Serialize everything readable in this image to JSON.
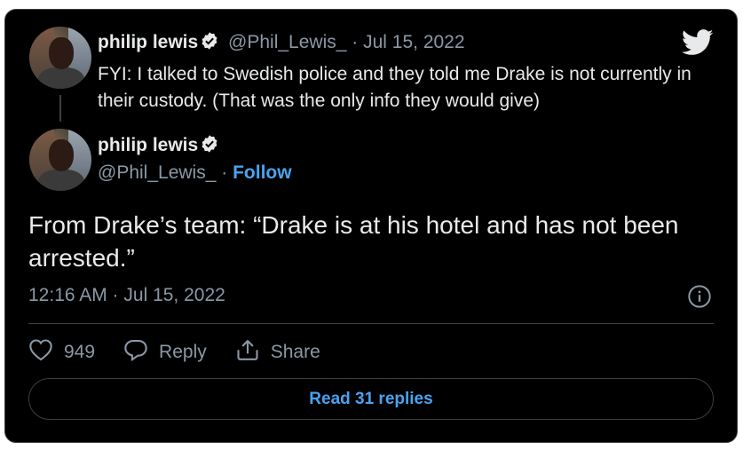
{
  "quoted_tweet": {
    "author_name": "philip lewis",
    "handle": "@Phil_Lewis_",
    "separator": "·",
    "date": "Jul 15, 2022",
    "text": "FYI: I talked to Swedish police and they told me Drake is not currently in their custody. (That was the only info they would give)"
  },
  "main_tweet": {
    "author_name": "philip lewis",
    "handle": "@Phil_Lewis_",
    "separator": "·",
    "follow_label": "Follow",
    "text": "From Drake’s team: “Drake is at his hotel and has not been arrested.”",
    "timestamp": "12:16 AM · Jul 15, 2022"
  },
  "actions": {
    "like_count": "949",
    "reply_label": "Reply",
    "share_label": "Share"
  },
  "read_replies_label": "Read 31 replies",
  "colors": {
    "background": "#000000",
    "text": "#e7e9ea",
    "muted": "#8b98a5",
    "accent": "#4aa3f0",
    "border": "#3a3f44"
  },
  "icons": [
    "verified-badge-icon",
    "twitter-bird-icon",
    "info-icon",
    "heart-icon",
    "reply-bubble-icon",
    "share-icon"
  ]
}
